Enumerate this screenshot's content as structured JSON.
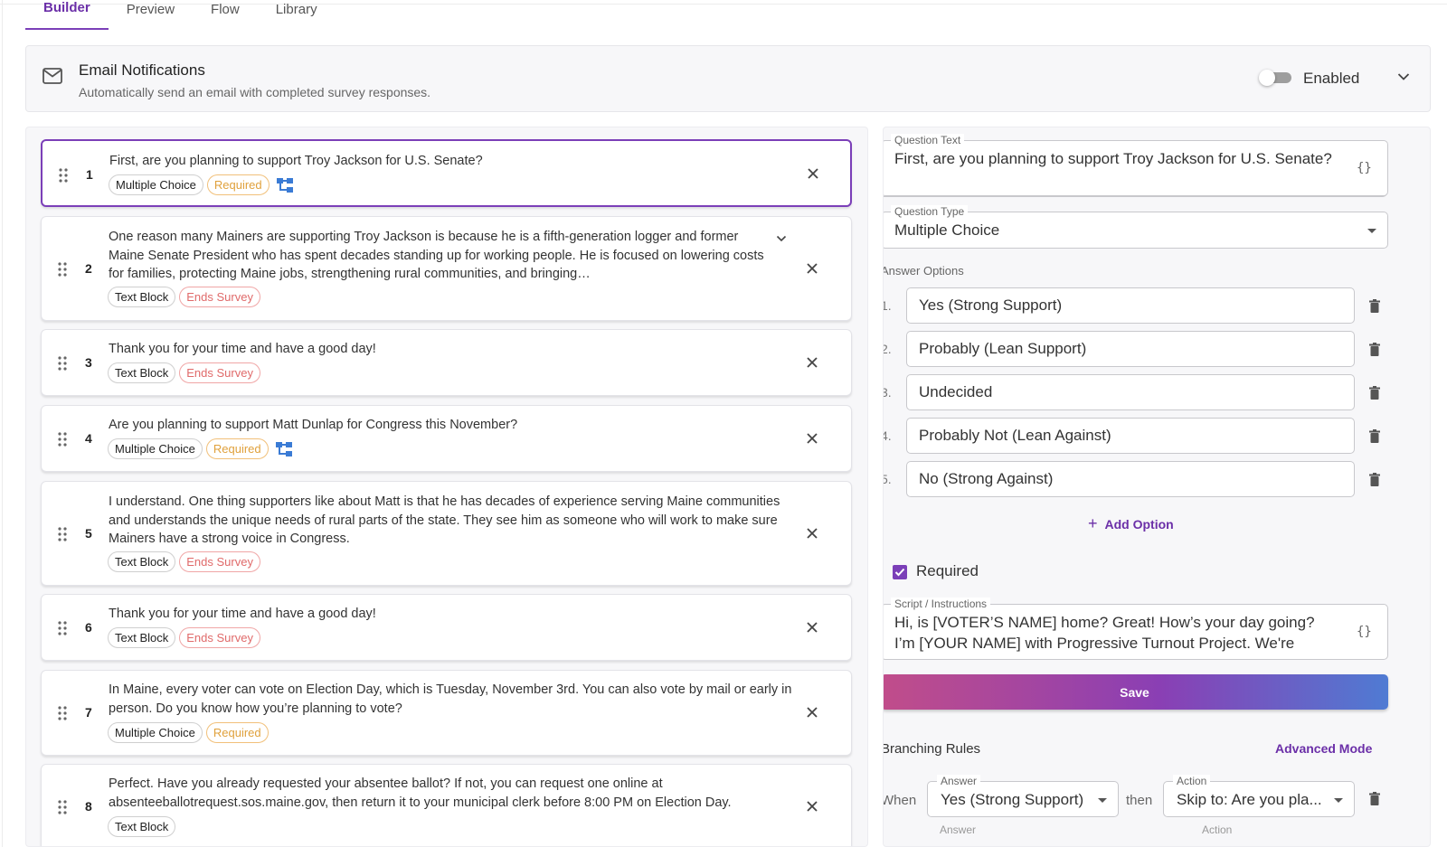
{
  "tabs": [
    {
      "label": "Builder",
      "active": true
    },
    {
      "label": "Preview",
      "active": false
    },
    {
      "label": "Flow",
      "active": false
    },
    {
      "label": "Library",
      "active": false
    }
  ],
  "email_notifications": {
    "title": "Email Notifications",
    "subtitle": "Automatically send an email with completed survey responses.",
    "toggle_label": "Enabled",
    "toggle_on": false,
    "icon": "mail-icon"
  },
  "questions": [
    {
      "num": "1",
      "text": "First, are you planning to support Troy Jackson for U.S. Senate?",
      "type": "Multiple Choice",
      "badge": "Required",
      "badge_kind": "required",
      "branching": true
    },
    {
      "num": "2",
      "text": "One reason many Mainers are supporting Troy Jackson is because he is a fifth-generation logger and former Maine Senate President who has spent decades standing up for working people. He is focused on lowering costs for families, protecting Maine jobs, strengthening rural communities, and bringing…",
      "type": "Text Block",
      "badge": "Ends Survey",
      "badge_kind": "ends",
      "expandable": true
    },
    {
      "num": "3",
      "text": "Thank you for your time and have a good day!",
      "type": "Text Block",
      "badge": "Ends Survey",
      "badge_kind": "ends"
    },
    {
      "num": "4",
      "text": "Are you planning to support Matt Dunlap for Congress this November?",
      "type": "Multiple Choice",
      "badge": "Required",
      "badge_kind": "required",
      "branching": true
    },
    {
      "num": "5",
      "text": "I understand. One thing supporters like about Matt is that he has decades of experience serving Maine communities and understands the unique needs of rural parts of the state. They see him as someone who will work to make sure Mainers have a strong voice in Congress.",
      "type": "Text Block",
      "badge": "Ends Survey",
      "badge_kind": "ends"
    },
    {
      "num": "6",
      "text": "Thank you for your time and have a good day!",
      "type": "Text Block",
      "badge": "Ends Survey",
      "badge_kind": "ends"
    },
    {
      "num": "7",
      "text": "In Maine, every voter can vote on Election Day, which is Tuesday, November 3rd. You can also vote by mail or early in person. Do you know how you’re planning to vote?",
      "type": "Multiple Choice",
      "badge": "Required",
      "badge_kind": "required"
    },
    {
      "num": "8",
      "text": "Perfect. Have you already requested your absentee ballot? If not, you can request one online at absenteeballotrequest.sos.maine.gov, then return it to your municipal clerk before 8:00 PM on Election Day.",
      "type": "Text Block"
    }
  ],
  "editor": {
    "question_text_label": "Question Text",
    "question_text": "First, are you planning to support Troy Jackson for U.S. Senate?",
    "question_type_label": "Question Type",
    "question_type": "Multiple Choice",
    "answer_options_label": "Answer Options",
    "options": [
      {
        "num": "1.",
        "label": "Yes (Strong Support)"
      },
      {
        "num": "2.",
        "label": "Probably (Lean Support)"
      },
      {
        "num": "3.",
        "label": "Undecided"
      },
      {
        "num": "4.",
        "label": "Probably Not (Lean Against)"
      },
      {
        "num": "5.",
        "label": "No (Strong Against)"
      }
    ],
    "add_option": "Add Option",
    "required_label": "Required",
    "required_checked": true,
    "script_label": "Script / Instructions",
    "script_text": "Hi, is [VOTER’S NAME] home? Great! How’s your day going? I’m [YOUR NAME] with Progressive Turnout Project. We're",
    "save_label": "Save",
    "branching_title": "Branching Rules",
    "advanced_mode": "Advanced Mode",
    "rule": {
      "when": "When",
      "answer_label": "Answer",
      "answer_value": "Yes (Strong Support)",
      "then": "then",
      "action_label": "Action",
      "action_value": "Skip to: Are you pla..."
    },
    "next_answer_label": "Answer",
    "next_action_label": "Action"
  },
  "colors": {
    "accent": "#7b3fb8",
    "required": "#e0a13c",
    "ends_survey": "#e06a6a",
    "save_gradient_start": "#c14d8a",
    "save_gradient_end": "#4f7bd3"
  }
}
